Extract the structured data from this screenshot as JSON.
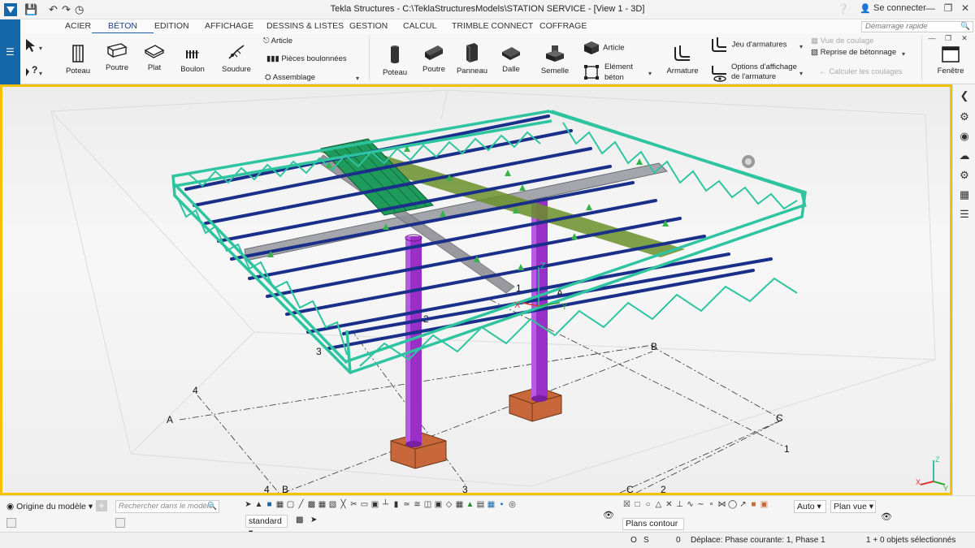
{
  "app": {
    "title": "Tekla Structures - C:\\TeklaStructuresModels\\STATION SERVICE  - [View 1 - 3D]",
    "sign_in": "Se connecter",
    "quick_launch_placeholder": "Démarrage rapide",
    "accent": "#1567a8",
    "viewport_border": "#f2c200"
  },
  "tabs": [
    "ACIER",
    "BÉTON",
    "EDITION",
    "AFFICHAGE",
    "DESSINS & LISTES",
    "GESTION",
    "CALCUL",
    "TRIMBLE CONNECT",
    "COFFRAGE"
  ],
  "ribbon": {
    "steel": {
      "poteau": "Poteau",
      "poutre": "Poutre",
      "plat": "Plat",
      "boulon": "Boulon",
      "soudure": "Soudure",
      "article": "Article",
      "pieces_boulonnees": "Pièces boulonnées",
      "assemblage": "Assemblage"
    },
    "concrete": {
      "poteau": "Poteau",
      "poutre": "Poutre",
      "panneau": "Panneau",
      "dalle": "Dalle",
      "semelle": "Semelle",
      "article": "Article",
      "element_beton_1": "Elément",
      "element_beton_2": "béton",
      "armature": "Armature",
      "jeu_armatures": "Jeu d'armatures",
      "options_1": "Options d'affichage",
      "options_2": "de l'armature",
      "vue_coulage": "Vue de coulage",
      "reprise": "Reprise de bétonnage",
      "calculer": "Calculer les coulages",
      "fenetre": "Fenêtre"
    }
  },
  "viewport": {
    "grid_labels": {
      "a_left": "A",
      "b_bottom": "B",
      "c_bottom": "C",
      "four_left": "4",
      "four_bottom": "4",
      "three_bottom": "3",
      "two_bottom": "2",
      "c_right": "C",
      "one_right": "1",
      "b_mid": "B",
      "three_mid": "3",
      "two_mid": "2",
      "one_mid": "1",
      "a_mid": "A"
    },
    "axis": {
      "x": "X",
      "y": "Y",
      "z": "Z"
    },
    "colors": {
      "truss": "#2ec4a0",
      "purlin": "#1a2f8a",
      "column": "#9a2fc7",
      "footing": "#c8683a",
      "beam": "#8f8f96",
      "slab": "#6b8f2a",
      "deck": "#1e9a5a"
    }
  },
  "bottom": {
    "origin": "Origine du modèle",
    "search_placeholder": "Rechercher dans le modèle",
    "standard": "standard",
    "auto": "Auto",
    "plan_vue": "Plan vue",
    "plans_contour": "Plans contour"
  },
  "status": {
    "o": "O",
    "s": "S",
    "zero": "0",
    "message": "Déplace: Phase courante: 1, Phase 1",
    "selection": "1 + 0 objets sélectionnés"
  }
}
